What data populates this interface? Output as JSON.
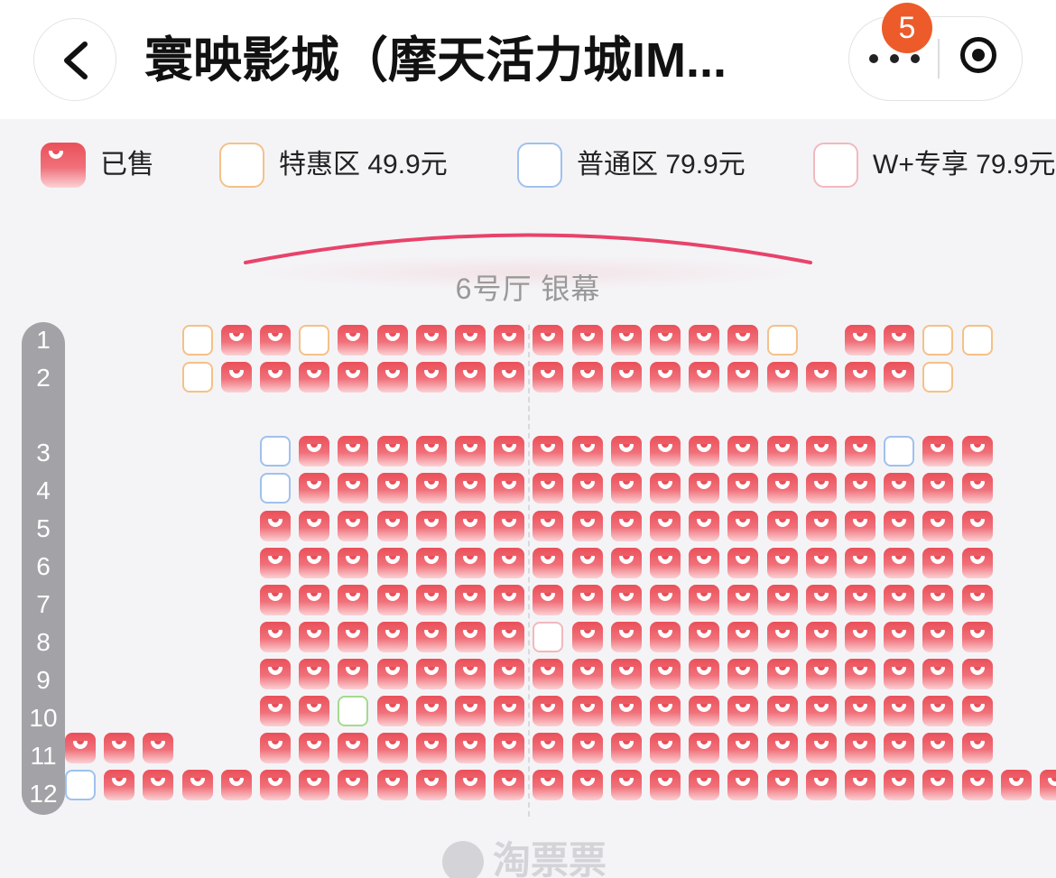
{
  "topbar": {
    "title": "寰映影城（摩天活力城IM...",
    "badge_count": "5",
    "back_icon": "chevron-left-icon",
    "more_icon": "more-dots-icon",
    "record_icon": "record-icon"
  },
  "legend": [
    {
      "status": "sold",
      "label": "已售",
      "color": "#e9505a"
    },
    {
      "status": "tehui",
      "label": "特惠区 49.9元",
      "color": "#f4c187"
    },
    {
      "status": "putong",
      "label": "普通区 79.9元",
      "color": "#9fc1ee"
    },
    {
      "status": "wplus",
      "label": "W+专享 79.9元",
      "color": "#f2b8bd"
    }
  ],
  "hall": {
    "screen_label": "6号厅 银幕"
  },
  "rows": [
    {
      "label": "1",
      "seats": "...TSSTSSSSSSSSSSST.SSTT"
    },
    {
      "label": "2",
      "seats": "...TSSSSSSSSSSSSSSSSSST"
    },
    {
      "label": "3",
      "seats": ".....PSSSSSSSSSSSSSSSPSS"
    },
    {
      "label": "4",
      "seats": ".....PSSSSSSSSSSSSSSSSSS"
    },
    {
      "label": "5",
      "seats": ".....SSSSSSSSSSSSSSSSSSS"
    },
    {
      "label": "6",
      "seats": ".....SSSSSSSSSSSSSSSSSSS"
    },
    {
      "label": "7",
      "seats": ".....SSSSSSSSSSSSSSSSSSS"
    },
    {
      "label": "8",
      "seats": ".....SSSSSSSWSSSSSSSSSSS"
    },
    {
      "label": "9",
      "seats": ".....SSSSSSSSSSSSSSSSSSS"
    },
    {
      "label": "10",
      "seats": ".....SSGSSSSSSSSSSSSSSSS"
    },
    {
      "label": "11",
      "seats": "SSS..SSSSSSSSSSSSSSSSSSS"
    },
    {
      "label": "12",
      "seats": "PSSSSSSSSSSSSSSSSSSSSSSSSS"
    }
  ],
  "seat_codes": {
    "S": "sold",
    "T": "tehui",
    "P": "putong",
    "W": "wplus",
    "G": "pick"
  },
  "watermark": {
    "text": "淘票票",
    "logo_icon": "taopiaopiao-logo-icon"
  }
}
